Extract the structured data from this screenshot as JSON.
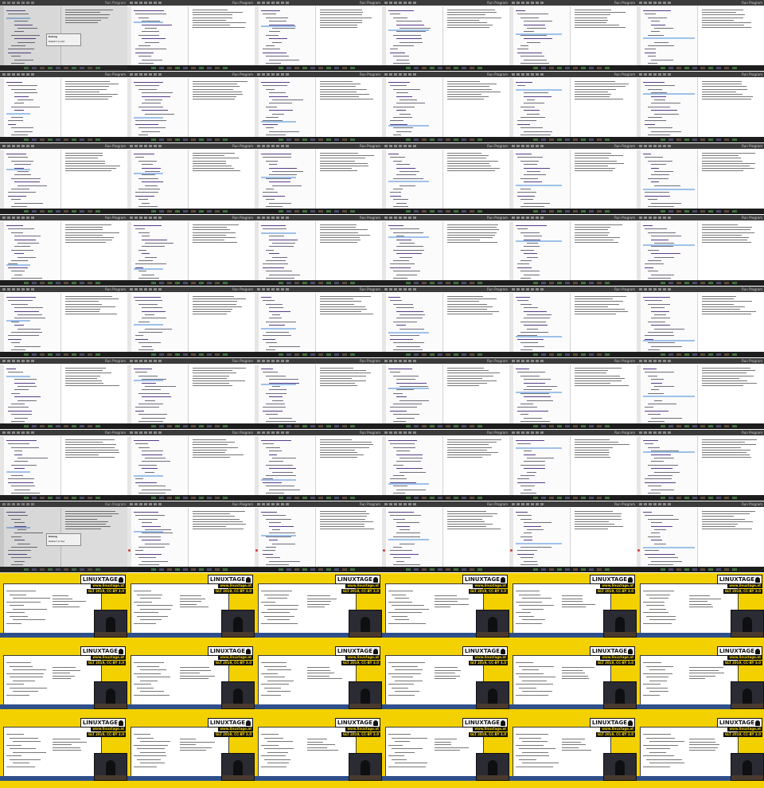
{
  "sheet": {
    "columns": 6,
    "rows": 11
  },
  "ide": {
    "run_label": "Run Program",
    "popup_title": "Debug",
    "popup_item": "Restart script"
  },
  "event": {
    "brand_text": "LINUXTAGE",
    "url_text": "www.linuxtage.at",
    "date_text": "GLT 2019, CC-BY 3.0"
  },
  "colors": {
    "toolbar": "#3b3b3b",
    "editor": "#fbfbfb",
    "highlight": "#9ec1ea",
    "event_yellow": "#f3d100",
    "breakpoint": "#d23b3b"
  },
  "icons": [
    "run-icon",
    "step-icon",
    "stop-icon",
    "save-icon",
    "open-icon",
    "tux-icon",
    "breakpoint-icon"
  ]
}
